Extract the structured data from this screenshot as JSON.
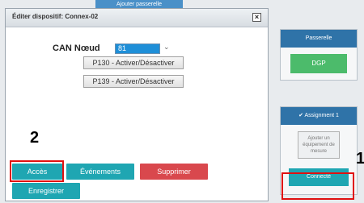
{
  "top_tab": {
    "label": "Ajouter passerelle"
  },
  "dialog": {
    "title": "Éditer dispositif: Connex-02",
    "close_symbol": "×",
    "can_label": "CAN Nœud",
    "can_value": "81",
    "chevron": "⌄",
    "buttons": {
      "p130": "P130 - Activer/Désactiver",
      "p139": "P139 - Activer/Désactiver"
    },
    "footer": {
      "acces": "Accès",
      "evenements": "Événements",
      "supprimer": "Supprimer",
      "enregistrer": "Enregistrer"
    }
  },
  "markers": {
    "two": "2",
    "one": "1"
  },
  "passerelle": {
    "header": "Passerelle",
    "button": "DGP"
  },
  "assignment": {
    "header": "✔ Assignment 1",
    "placeholder": "Ajouter un équipement de mesure",
    "button": "Connecté"
  },
  "colors": {
    "teal": "#1fa6b2",
    "red": "#d9484d",
    "green": "#4cbb6b",
    "header_blue": "#2f73a8",
    "highlight_red": "#e01010"
  }
}
